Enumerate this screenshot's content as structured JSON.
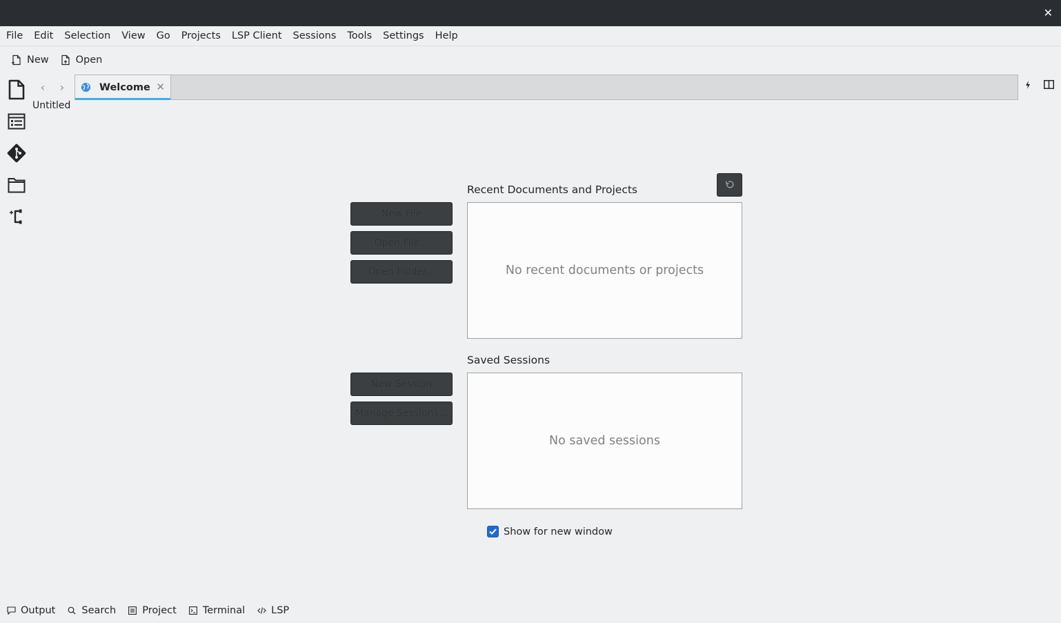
{
  "titlebar": {
    "close_glyph": "✕"
  },
  "menu": [
    "File",
    "Edit",
    "Selection",
    "View",
    "Go",
    "Projects",
    "LSP Client",
    "Sessions",
    "Tools",
    "Settings",
    "Help"
  ],
  "toolbar": {
    "new_label": "New",
    "open_label": "Open"
  },
  "sidebar": {
    "icons": [
      "documents-icon",
      "symbols-outline-icon",
      "git-icon",
      "filesystem-browser-icon",
      "project-tree-icon"
    ]
  },
  "tabs": [
    {
      "label": "Welcome",
      "icon": "globe-icon",
      "close_glyph": "✕",
      "active": true
    }
  ],
  "nav": {
    "back_glyph": "‹",
    "forward_glyph": "›"
  },
  "document_list": {
    "untitled_label": "Untitled"
  },
  "welcome": {
    "recent_title": "Recent Documents and Projects",
    "recent_empty": "No recent documents or projects",
    "new_file": "New File",
    "open_file": "Open File...",
    "open_folder": "Open Folder...",
    "sessions_title": "Saved Sessions",
    "sessions_empty": "No saved sessions",
    "new_session": "New Session",
    "manage_sessions": "Manage Sessions...",
    "show_for_new_window": "Show for new window",
    "show_for_new_window_checked": true
  },
  "statusbar": {
    "output": "Output",
    "search": "Search",
    "project": "Project",
    "terminal": "Terminal",
    "lsp": "LSP"
  },
  "colors": {
    "titlebar": "#2a2e32",
    "background": "#eff0f1",
    "accent": "#3daee9",
    "checkbox": "#1d6bd0",
    "button_dark": "#3c3f41"
  }
}
